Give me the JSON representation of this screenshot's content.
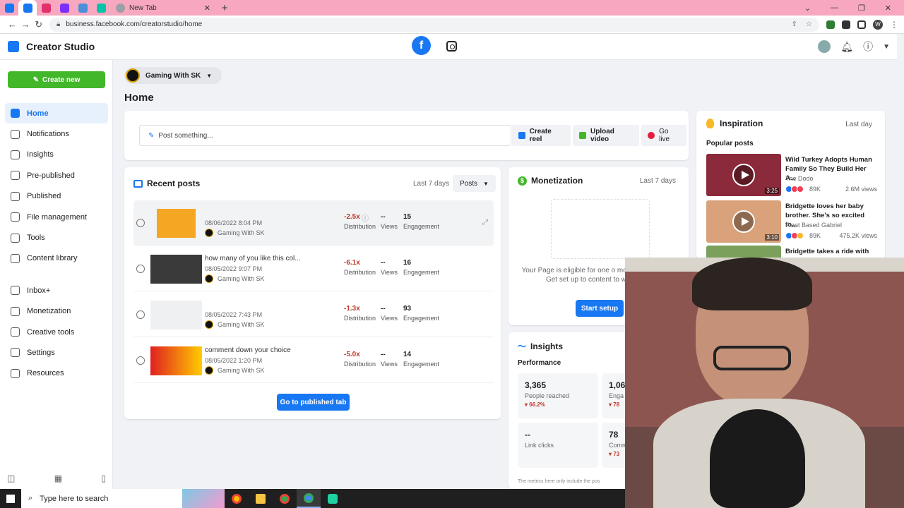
{
  "browser": {
    "url": "business.facebook.com/creatorstudio/home",
    "new_tab_label": "New Tab",
    "tab_close": "✕",
    "new_tab_plus": "+",
    "window_controls": [
      "⌄",
      "—",
      "❐",
      "✕"
    ],
    "profile_initial": "W"
  },
  "header": {
    "app_title": "Creator Studio",
    "fb_letter": "f"
  },
  "sidebar": {
    "create_label": "Create new",
    "items": [
      {
        "label": "Home",
        "icon": "home-icon"
      },
      {
        "label": "Notifications",
        "icon": "bell-icon"
      },
      {
        "label": "Insights",
        "icon": "chart-icon"
      },
      {
        "label": "Pre-published",
        "icon": "document-icon"
      },
      {
        "label": "Published",
        "icon": "document-icon"
      },
      {
        "label": "File management",
        "icon": "folder-icon"
      },
      {
        "label": "Tools",
        "icon": "tools-icon"
      },
      {
        "label": "Content library",
        "icon": "library-icon"
      }
    ],
    "items2": [
      {
        "label": "Inbox+",
        "icon": "inbox-icon"
      },
      {
        "label": "Monetization",
        "icon": "dollar-icon"
      },
      {
        "label": "Creative tools",
        "icon": "creative-icon"
      },
      {
        "label": "Settings",
        "icon": "gear-icon"
      },
      {
        "label": "Resources",
        "icon": "resources-icon"
      }
    ]
  },
  "page_selector": {
    "name": "Gaming With SK"
  },
  "main": {
    "title": "Home",
    "post_placeholder": "Post something...",
    "actions": {
      "reel": "Create reel",
      "upload": "Upload video",
      "live": "Go live"
    }
  },
  "recent": {
    "title": "Recent posts",
    "range": "Last 7 days",
    "filter": "Posts",
    "go_button": "Go to published tab",
    "labels": {
      "dist": "Distribution",
      "views": "Views",
      "eng": "Engagement"
    },
    "posts": [
      {
        "caption": "",
        "date": "08/06/2022 8:04 PM",
        "page": "Gaming With SK",
        "distribution": "-2.5x",
        "views": "--",
        "engagement": "15"
      },
      {
        "caption": "how many of you like this col...",
        "date": "08/05/2022 9:07 PM",
        "page": "Gaming With SK",
        "distribution": "-6.1x",
        "views": "--",
        "engagement": "16"
      },
      {
        "caption": "",
        "date": "08/05/2022 7:43 PM",
        "page": "Gaming With SK",
        "distribution": "-1.3x",
        "views": "--",
        "engagement": "93"
      },
      {
        "caption": "comment down your choice",
        "date": "08/05/2022 1:20 PM",
        "page": "Gaming With SK",
        "distribution": "-5.0x",
        "views": "--",
        "engagement": "14"
      }
    ]
  },
  "monetization": {
    "title": "Monetization",
    "range": "Last 7 days",
    "text": "Your Page is eligible for one o monetization tools. Get set up to content to work for y",
    "button": "Start setup"
  },
  "insights": {
    "title": "Insights",
    "performance": "Performance",
    "stats": [
      {
        "value": "3,365",
        "label": "People reached",
        "change": "▾ 66.2%"
      },
      {
        "value": "1,06",
        "label": "Enga",
        "change": "▾ 78"
      },
      {
        "value": "--",
        "label": "Link clicks",
        "change": ""
      },
      {
        "value": "78",
        "label": "Comm",
        "change": "▾ 73"
      }
    ],
    "footnote": "The metrics here only include the pos"
  },
  "inspiration": {
    "title": "Inspiration",
    "range": "Last day",
    "popular": "Popular posts",
    "videos": [
      {
        "title": "Wild Turkey Adopts Human Family So They Build Her A...",
        "source": "The Dodo",
        "duration": "3:25",
        "reactions": "89K",
        "views": "2.6M views"
      },
      {
        "title": "Bridgette loves her baby brother. She's so excited to...",
        "source": "Plant Based Gabriel",
        "duration": "3:10",
        "reactions": "89K",
        "views": "475.2K views"
      },
      {
        "title": "Bridgette takes a ride with her",
        "source": "",
        "duration": "",
        "reactions": "",
        "views": ""
      }
    ]
  },
  "taskbar": {
    "search_placeholder": "Type here to search"
  },
  "colors": {
    "brand": "#1877f2",
    "create": "#42b72a",
    "tabbar": "#f7a8c0"
  }
}
